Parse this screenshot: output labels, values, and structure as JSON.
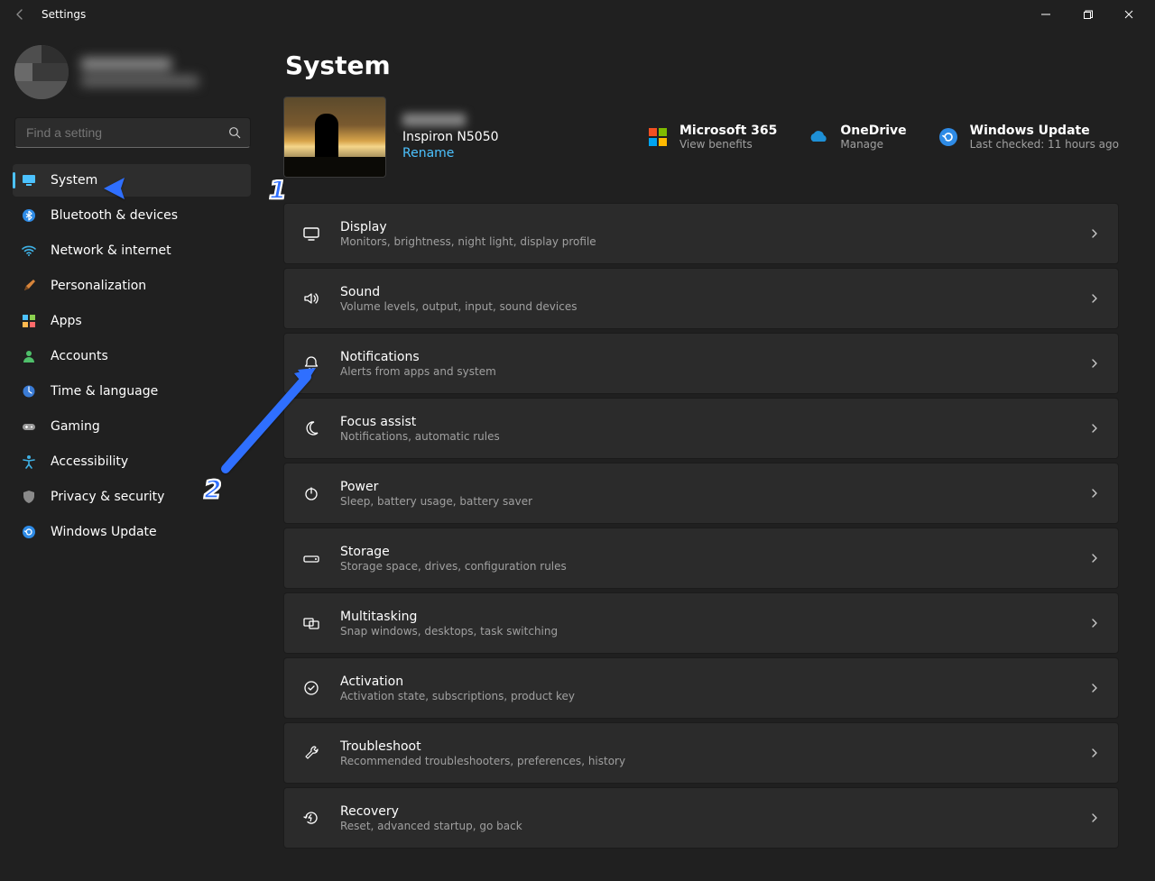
{
  "window": {
    "title": "Settings"
  },
  "user": {
    "name_obscured": true
  },
  "search": {
    "placeholder": "Find a setting"
  },
  "sidebar": {
    "items": [
      {
        "label": "System",
        "icon": "monitor-icon"
      },
      {
        "label": "Bluetooth & devices",
        "icon": "bluetooth-icon"
      },
      {
        "label": "Network & internet",
        "icon": "wifi-icon"
      },
      {
        "label": "Personalization",
        "icon": "brush-icon"
      },
      {
        "label": "Apps",
        "icon": "apps-icon"
      },
      {
        "label": "Accounts",
        "icon": "person-icon"
      },
      {
        "label": "Time & language",
        "icon": "clock-globe-icon"
      },
      {
        "label": "Gaming",
        "icon": "gamepad-icon"
      },
      {
        "label": "Accessibility",
        "icon": "accessibility-icon"
      },
      {
        "label": "Privacy & security",
        "icon": "shield-icon"
      },
      {
        "label": "Windows Update",
        "icon": "update-icon"
      }
    ],
    "selected_index": 0
  },
  "page": {
    "title": "System"
  },
  "device": {
    "model": "Inspiron N5050",
    "rename_label": "Rename"
  },
  "status": {
    "m365": {
      "label": "Microsoft 365",
      "sub": "View benefits"
    },
    "onedrive": {
      "label": "OneDrive",
      "sub": "Manage"
    },
    "update": {
      "label": "Windows Update",
      "sub": "Last checked: 11 hours ago"
    }
  },
  "cards": [
    {
      "title": "Display",
      "sub": "Monitors, brightness, night light, display profile",
      "icon": "display-icon"
    },
    {
      "title": "Sound",
      "sub": "Volume levels, output, input, sound devices",
      "icon": "sound-icon"
    },
    {
      "title": "Notifications",
      "sub": "Alerts from apps and system",
      "icon": "bell-icon"
    },
    {
      "title": "Focus assist",
      "sub": "Notifications, automatic rules",
      "icon": "moon-icon"
    },
    {
      "title": "Power",
      "sub": "Sleep, battery usage, battery saver",
      "icon": "power-icon"
    },
    {
      "title": "Storage",
      "sub": "Storage space, drives, configuration rules",
      "icon": "storage-icon"
    },
    {
      "title": "Multitasking",
      "sub": "Snap windows, desktops, task switching",
      "icon": "multitask-icon"
    },
    {
      "title": "Activation",
      "sub": "Activation state, subscriptions, product key",
      "icon": "check-circle-icon"
    },
    {
      "title": "Troubleshoot",
      "sub": "Recommended troubleshooters, preferences, history",
      "icon": "wrench-icon"
    },
    {
      "title": "Recovery",
      "sub": "Reset, advanced startup, go back",
      "icon": "recovery-icon"
    }
  ],
  "annotations": {
    "one": "1",
    "two": "2"
  }
}
